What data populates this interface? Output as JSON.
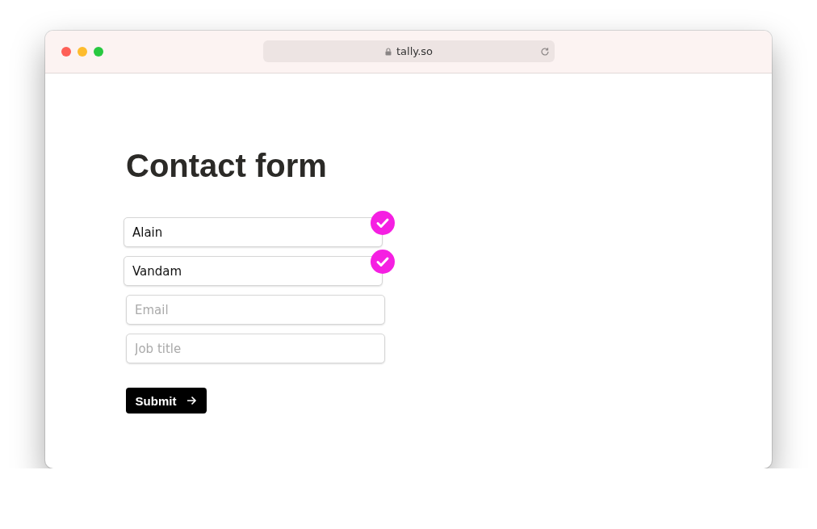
{
  "browser": {
    "address": "tally.so"
  },
  "form": {
    "title": "Contact form",
    "fields": [
      {
        "value": "Alain",
        "valid": true
      },
      {
        "value": "Vandam",
        "valid": true
      },
      {
        "placeholder": "Email",
        "valid": false
      },
      {
        "placeholder": "Job title",
        "valid": false
      }
    ],
    "submit": "Submit"
  }
}
